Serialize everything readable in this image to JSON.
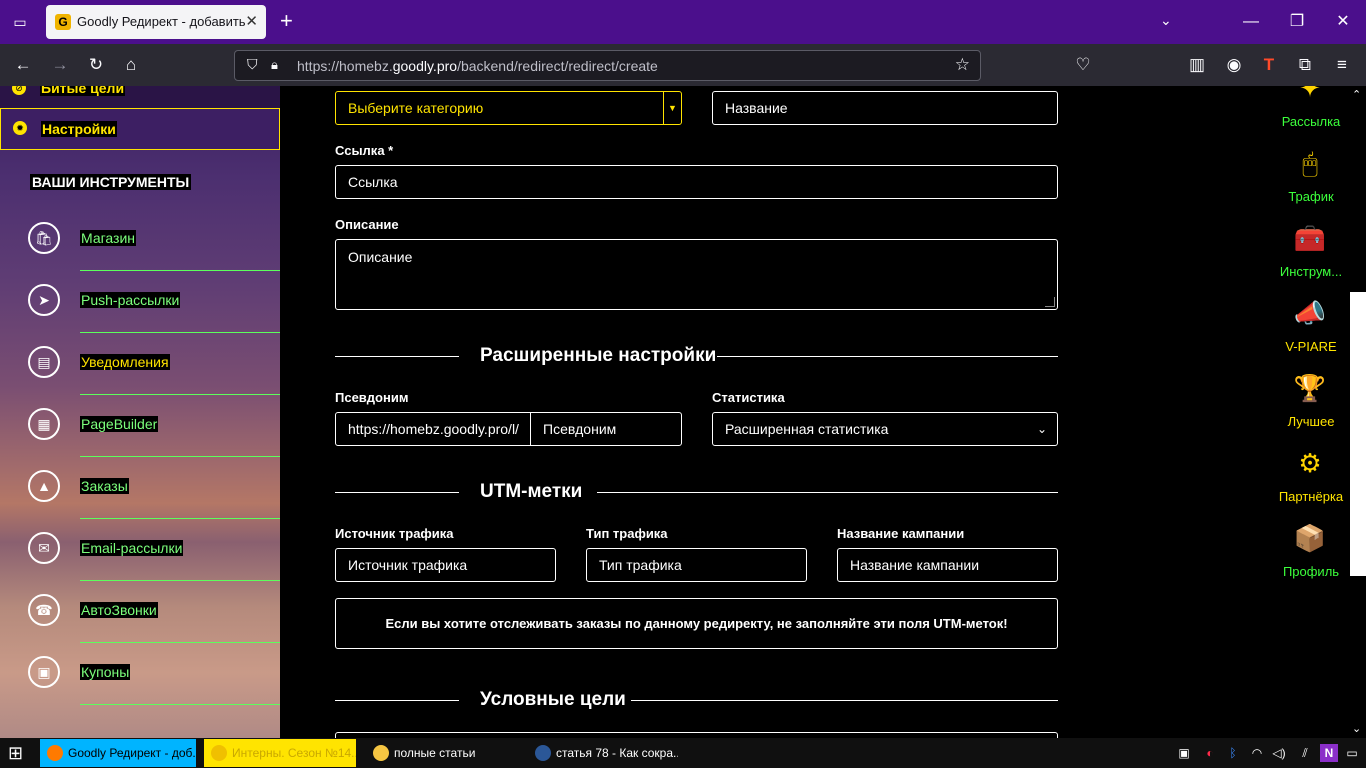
{
  "browser": {
    "tab_title": "Goodly Редирект - добавить",
    "tab_favicon": "G",
    "url_prefix": "https://homebz.",
    "url_domain": "goodly.pro",
    "url_path": "/backend/redirect/redirect/create"
  },
  "sidebar": {
    "top_item": "Битые цели",
    "settings_item": "Настройки",
    "section_title": "ВАШИ ИНСТРУМЕНТЫ",
    "tools": [
      {
        "label": "Магазин",
        "icon": "shopping-bag-icon",
        "glyph": "🛍"
      },
      {
        "label": "Push-рассылки",
        "icon": "paper-plane-icon",
        "glyph": "➤"
      },
      {
        "label": "Уведомления",
        "icon": "document-icon",
        "glyph": "▤"
      },
      {
        "label": "PageBuilder",
        "icon": "page-builder-icon",
        "glyph": "▦"
      },
      {
        "label": "Заказы",
        "icon": "chart-icon",
        "glyph": "▲"
      },
      {
        "label": "Email-рассылки",
        "icon": "envelope-icon",
        "glyph": "✉"
      },
      {
        "label": "АвтоЗвонки",
        "icon": "phone-icon",
        "glyph": "☎"
      },
      {
        "label": "Купоны",
        "icon": "coupon-icon",
        "glyph": "▣"
      }
    ]
  },
  "form": {
    "category_placeholder": "Выберите категорию",
    "name_placeholder": "Название",
    "link_label": "Ссылка *",
    "link_placeholder": "Ссылка",
    "description_label": "Описание",
    "description_placeholder": "Описание",
    "advanced_title": "Расширенные настройки",
    "alias_label": "Псевдоним",
    "alias_prefix": "https://homebz.goodly.pro/l/",
    "alias_placeholder": "Псевдоним",
    "stats_label": "Статистика",
    "stats_value": "Расширенная статистика",
    "utm_title": "UTM-метки",
    "source_label": "Источник трафика",
    "source_placeholder": "Источник трафика",
    "type_label": "Тип трафика",
    "type_placeholder": "Тип трафика",
    "campaign_label": "Название кампании",
    "campaign_placeholder": "Название кампании",
    "utm_notice": "Если вы хотите отслеживать заказы по данному редиректу, не заполняйте эти поля UTM-меток!",
    "goals_title": "Условные цели"
  },
  "right_tools": [
    {
      "label": "Рассылка",
      "icon": "mailing-icon",
      "glyph": "✦",
      "color": "#3cff3c"
    },
    {
      "label": "Трафик",
      "icon": "mouse-icon",
      "glyph": "🖱",
      "color": "#3cff3c"
    },
    {
      "label": "Инструм...",
      "icon": "toolbox-icon",
      "glyph": "🧰",
      "color": "#3cff3c"
    },
    {
      "label": "V-PIARE",
      "icon": "megaphone-icon",
      "glyph": "📣",
      "color": "#ffe400"
    },
    {
      "label": "Лучшее",
      "icon": "award-icon",
      "glyph": "🏆",
      "color": "#ffe400"
    },
    {
      "label": "Партнёрка",
      "icon": "gear-icon",
      "glyph": "⚙",
      "color": "#ffe400"
    },
    {
      "label": "Профиль",
      "icon": "profile-box-icon",
      "glyph": "📦",
      "color": "#3cff3c"
    }
  ],
  "taskbar": {
    "items": [
      {
        "label": "Goodly Редирект - доб...",
        "bg": "#00b4ff",
        "color": "#000",
        "icon": "firefox-icon"
      },
      {
        "label": "Интерны. Сезон №14...",
        "bg": "#ffe400",
        "color": "#c9a800",
        "icon": "media-player-icon"
      },
      {
        "label": "полные статьи",
        "bg": "#101010",
        "color": "#fff",
        "icon": "folder-icon"
      },
      {
        "label": "статья 78 - Как сокра...",
        "bg": "#101010",
        "color": "#fff",
        "icon": "word-icon"
      }
    ]
  },
  "colors": {
    "accent_yellow": "#ffe400",
    "accent_green": "#7cff7c",
    "tab_bar": "#4b0f8c"
  }
}
